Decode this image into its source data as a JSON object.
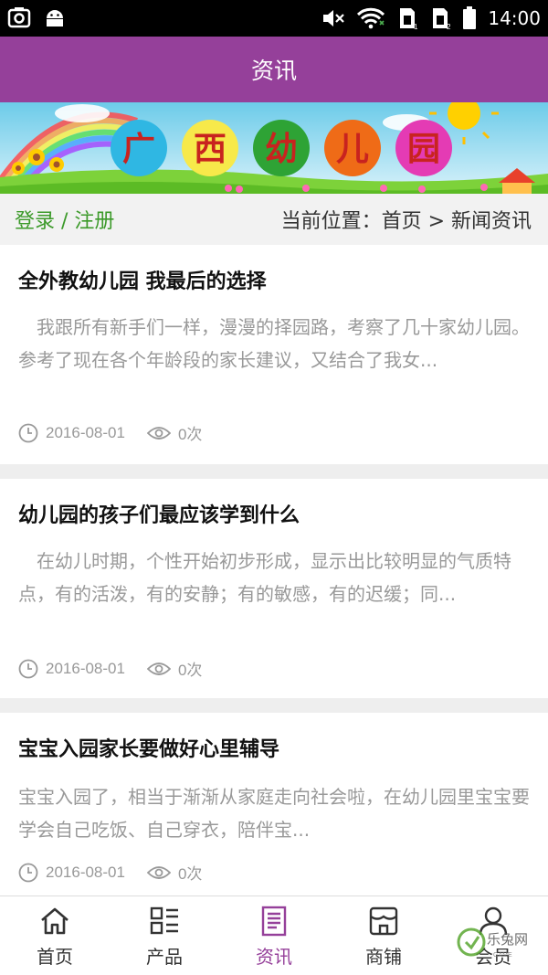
{
  "status_bar": {
    "time": "14:00"
  },
  "header": {
    "title": "资讯"
  },
  "banner": {
    "chars": [
      "广",
      "西",
      "幼",
      "儿",
      "园"
    ],
    "circle_colors": [
      "#2fb7e3",
      "#f7e94a",
      "#2ea335",
      "#ef6b17",
      "#e43bb4"
    ],
    "char_color": "#c8231f"
  },
  "crumb": {
    "login": "登录",
    "sep": " / ",
    "register": "注册",
    "location": "当前位置：首页 > 新闻资讯"
  },
  "articles": [
    {
      "title": "全外教幼儿园 我最后的选择",
      "body": "　我跟所有新手们一样，漫漫的择园路，考察了几十家幼儿园。参考了现在各个年龄段的家长建议，又结合了我女...",
      "date": "2016-08-01",
      "views": "0次"
    },
    {
      "title": "幼儿园的孩子们最应该学到什么",
      "body": "　在幼儿时期，个性开始初步形成，显示出比较明显的气质特点，有的活泼，有的安静；有的敏感，有的迟缓；同...",
      "date": "2016-08-01",
      "views": "0次"
    },
    {
      "title": "宝宝入园家长要做好心里辅导",
      "body": "宝宝入园了，相当于渐渐从家庭走向社会啦，在幼儿园里宝宝要学会自己吃饭、自己穿衣，陪伴宝...",
      "date": "2016-08-01",
      "views": "0次"
    }
  ],
  "tabs": [
    {
      "label": "首页",
      "icon": "home-icon"
    },
    {
      "label": "产品",
      "icon": "grid-list-icon"
    },
    {
      "label": "资讯",
      "icon": "document-icon",
      "active": true
    },
    {
      "label": "商铺",
      "icon": "store-icon"
    },
    {
      "label": "会员",
      "icon": "user-icon"
    }
  ],
  "watermark": {
    "text": "乐兔网"
  },
  "colors": {
    "primary": "#95409a",
    "link_green": "#3c9a2a"
  }
}
